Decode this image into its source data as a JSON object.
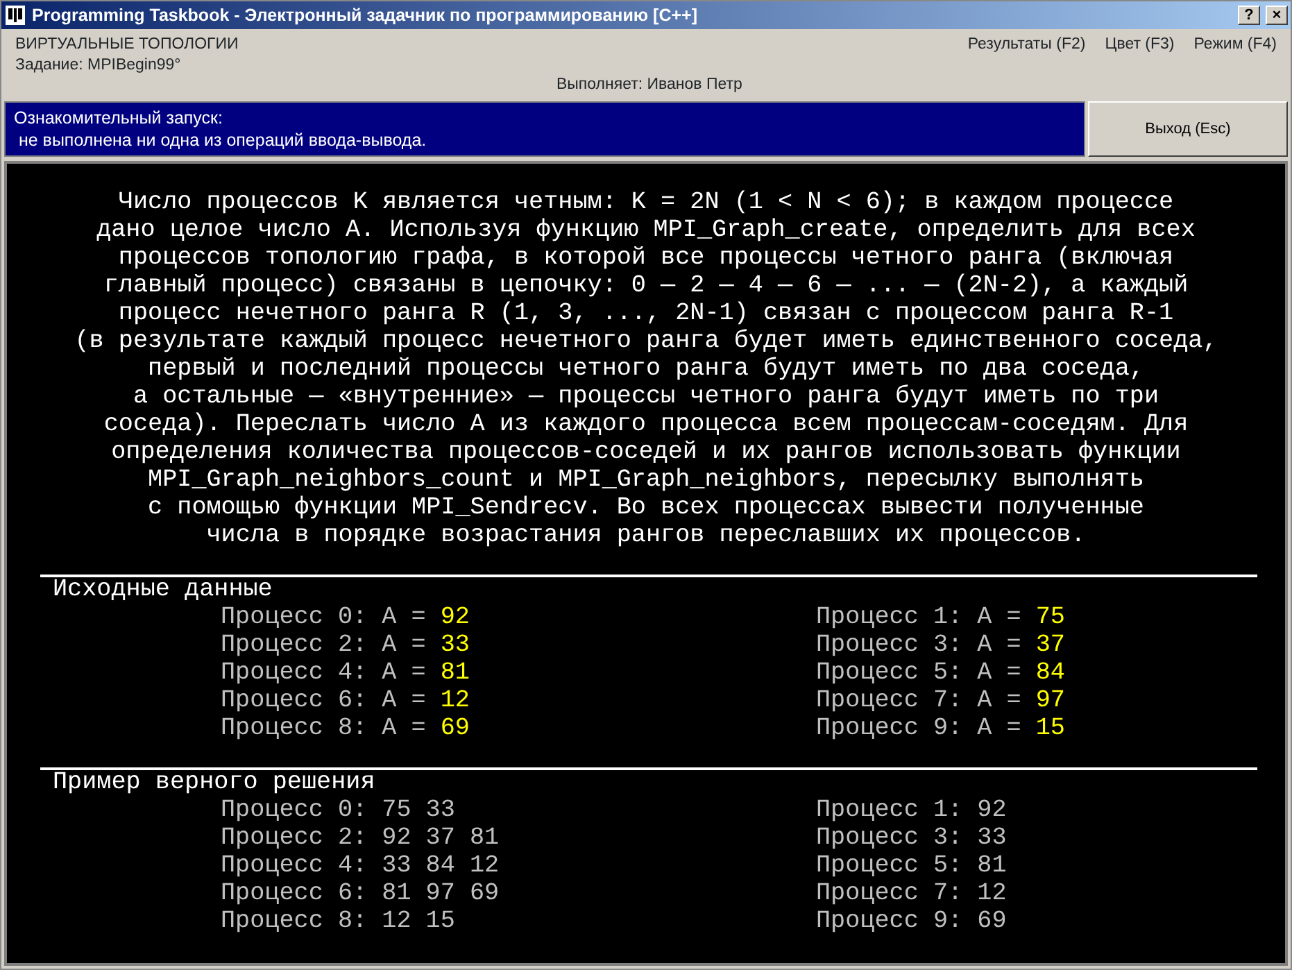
{
  "window": {
    "title": "Programming Taskbook - Электронный задачник по программированию [C++]",
    "buttons": [
      "?",
      "×"
    ]
  },
  "header": {
    "group": "ВИРТУАЛЬНЫЕ ТОПОЛОГИИ",
    "task": "Задание: MPIBegin99°",
    "student": "Выполняет: Иванов Петр",
    "menu": [
      "Результаты (F2)",
      "Цвет (F3)",
      "Режим (F4)"
    ]
  },
  "status": {
    "lines": [
      "Ознакомительный запуск:",
      " не выполнена ни одна из операций ввода-вывода."
    ],
    "button": "Выход (Esc)"
  },
  "description": [
    "Число процессов K является четным: K = 2N (1 < N < 6); в каждом процессе",
    "дано целое число A. Используя функцию MPI_Graph_create, определить для всех",
    "процессов топологию графа, в которой все процессы четного ранга (включая",
    "главный процесс) связаны в цепочку: 0 — 2 — 4 — 6 — ... — (2N-2), а каждый",
    "процесс нечетного ранга R (1, 3, ..., 2N-1) связан с процессом ранга R-1",
    "(в результате каждый процесс нечетного ранга будет иметь единственного соседа,",
    "первый и последний процессы четного ранга будут иметь по два соседа,",
    "а остальные — «внутренние» — процессы четного ранга будут иметь по три",
    "соседа). Переслать число A из каждого процесса всем процессам-соседям. Для",
    "определения количества процессов-соседей и их рангов использовать функции",
    "MPI_Graph_neighbors_count и MPI_Graph_neighbors, пересылку выполнять",
    "с помощью функции MPI_Sendrecv. Во всех процессах вывести полученные",
    "числа в порядке возрастания рангов переславших их процессов."
  ],
  "sections": [
    {
      "kind": "input",
      "title": "Исходные данные",
      "items": [
        {
          "label": "Процесс 0: A = ",
          "value": "92"
        },
        {
          "label": "Процесс 1: A = ",
          "value": "75"
        },
        {
          "label": "Процесс 2: A = ",
          "value": "33"
        },
        {
          "label": "Процесс 3: A = ",
          "value": "37"
        },
        {
          "label": "Процесс 4: A = ",
          "value": "81"
        },
        {
          "label": "Процесс 5: A = ",
          "value": "84"
        },
        {
          "label": "Процесс 6: A = ",
          "value": "12"
        },
        {
          "label": "Процесс 7: A = ",
          "value": "97"
        },
        {
          "label": "Процесс 8: A = ",
          "value": "69"
        },
        {
          "label": "Процесс 9: A = ",
          "value": "15"
        }
      ]
    },
    {
      "kind": "result",
      "title": "Пример верного решения",
      "items": [
        {
          "label": "Процесс 0: ",
          "value": "75 33"
        },
        {
          "label": "Процесс 1: ",
          "value": "92"
        },
        {
          "label": "Процесс 2: ",
          "value": "92 37 81"
        },
        {
          "label": "Процесс 3: ",
          "value": "33"
        },
        {
          "label": "Процесс 4: ",
          "value": "33 84 12"
        },
        {
          "label": "Процесс 5: ",
          "value": "81"
        },
        {
          "label": "Процесс 6: ",
          "value": "81 97 69"
        },
        {
          "label": "Процесс 7: ",
          "value": "12"
        },
        {
          "label": "Процесс 8: ",
          "value": "12 15"
        },
        {
          "label": "Процесс 9: ",
          "value": "69"
        }
      ]
    }
  ]
}
